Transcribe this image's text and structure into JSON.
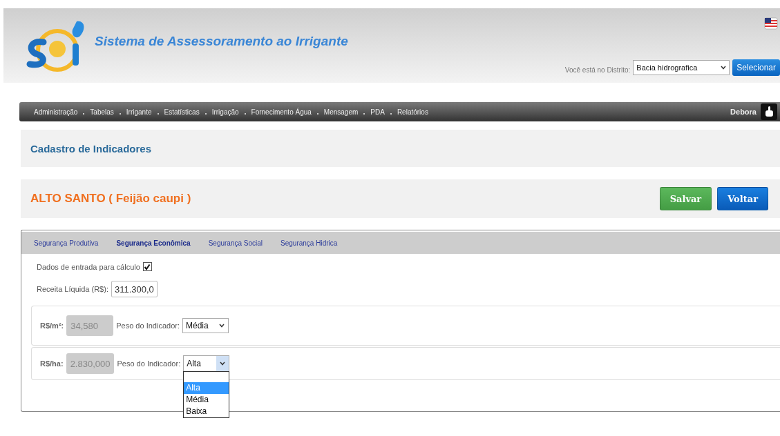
{
  "header": {
    "title": "Sistema de Assessoramento ao Irrigante",
    "district_label": "Você está no Distrito:",
    "district_value": "Bacia hidrografica",
    "select_button": "Selecionar"
  },
  "nav": {
    "items": [
      "Administração",
      "Tabelas",
      "Irrigante",
      "Estatísticas",
      "Irrigação",
      "Fornecimento Água",
      "Mensagem",
      "PDA",
      "Relatórios"
    ],
    "user": "Debora"
  },
  "page_title": "Cadastro de Indicadores",
  "record": {
    "title": "ALTO SANTO ( Feijão caupi )",
    "buttons": [
      {
        "label": "Salvar",
        "kind": "success"
      },
      {
        "label": "Voltar",
        "kind": "primary"
      }
    ]
  },
  "tabs": [
    {
      "label": "Segurança Produtiva",
      "selected": false
    },
    {
      "label": "Segurança Econômica",
      "selected": true
    },
    {
      "label": "Segurança Social",
      "selected": false
    },
    {
      "label": "Segurança Hidrica",
      "selected": false
    }
  ],
  "form": {
    "checkbox": {
      "label": "Dados de entrada para cálculo",
      "checked": true
    },
    "revenue": {
      "label": "Receita Líquida (R$):",
      "value": "311.300,0"
    },
    "indicators": [
      {
        "label": "R$/m²:",
        "value": "34,580",
        "weight_label": "Peso do Indicador:",
        "weight": "Média",
        "expanded": false
      },
      {
        "label": "R$/ha:",
        "value": "2.830,000",
        "weight_label": "Peso do Indicador:",
        "weight": "Alta",
        "expanded": true,
        "options": [
          {
            "label": "Alta",
            "selected": true
          },
          {
            "label": "Média",
            "selected": false
          },
          {
            "label": "Baixa",
            "selected": false
          }
        ]
      }
    ]
  }
}
